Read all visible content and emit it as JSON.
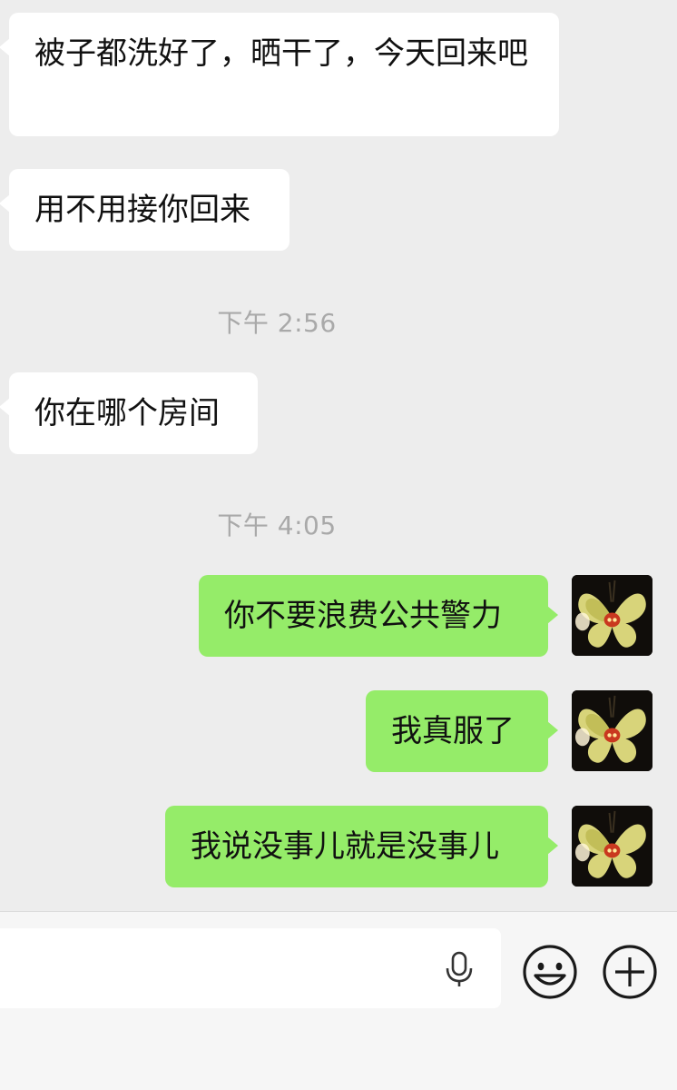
{
  "messages": [
    {
      "direction": "in",
      "text": "被子都洗好了，晒干了，今天回来吧"
    },
    {
      "direction": "in",
      "text": "用不用接你回来"
    },
    {
      "type": "time",
      "text": "下午 2:56"
    },
    {
      "direction": "in",
      "text": "你在哪个房间"
    },
    {
      "type": "time",
      "text": "下午 4:05"
    },
    {
      "direction": "out",
      "text": "你不要浪费公共警力"
    },
    {
      "direction": "out",
      "text": "我真服了"
    },
    {
      "direction": "out",
      "text": "我说没事儿就是没事儿"
    }
  ],
  "input_bar": {
    "value": "",
    "icons": [
      "microphone-icon",
      "emoji-icon",
      "plus-icon"
    ]
  },
  "colors": {
    "background": "#ededed",
    "incoming_bubble": "#ffffff",
    "outgoing_bubble": "#95ec69",
    "timestamp": "#a9a9a9",
    "input_bar": "#f6f6f6"
  }
}
